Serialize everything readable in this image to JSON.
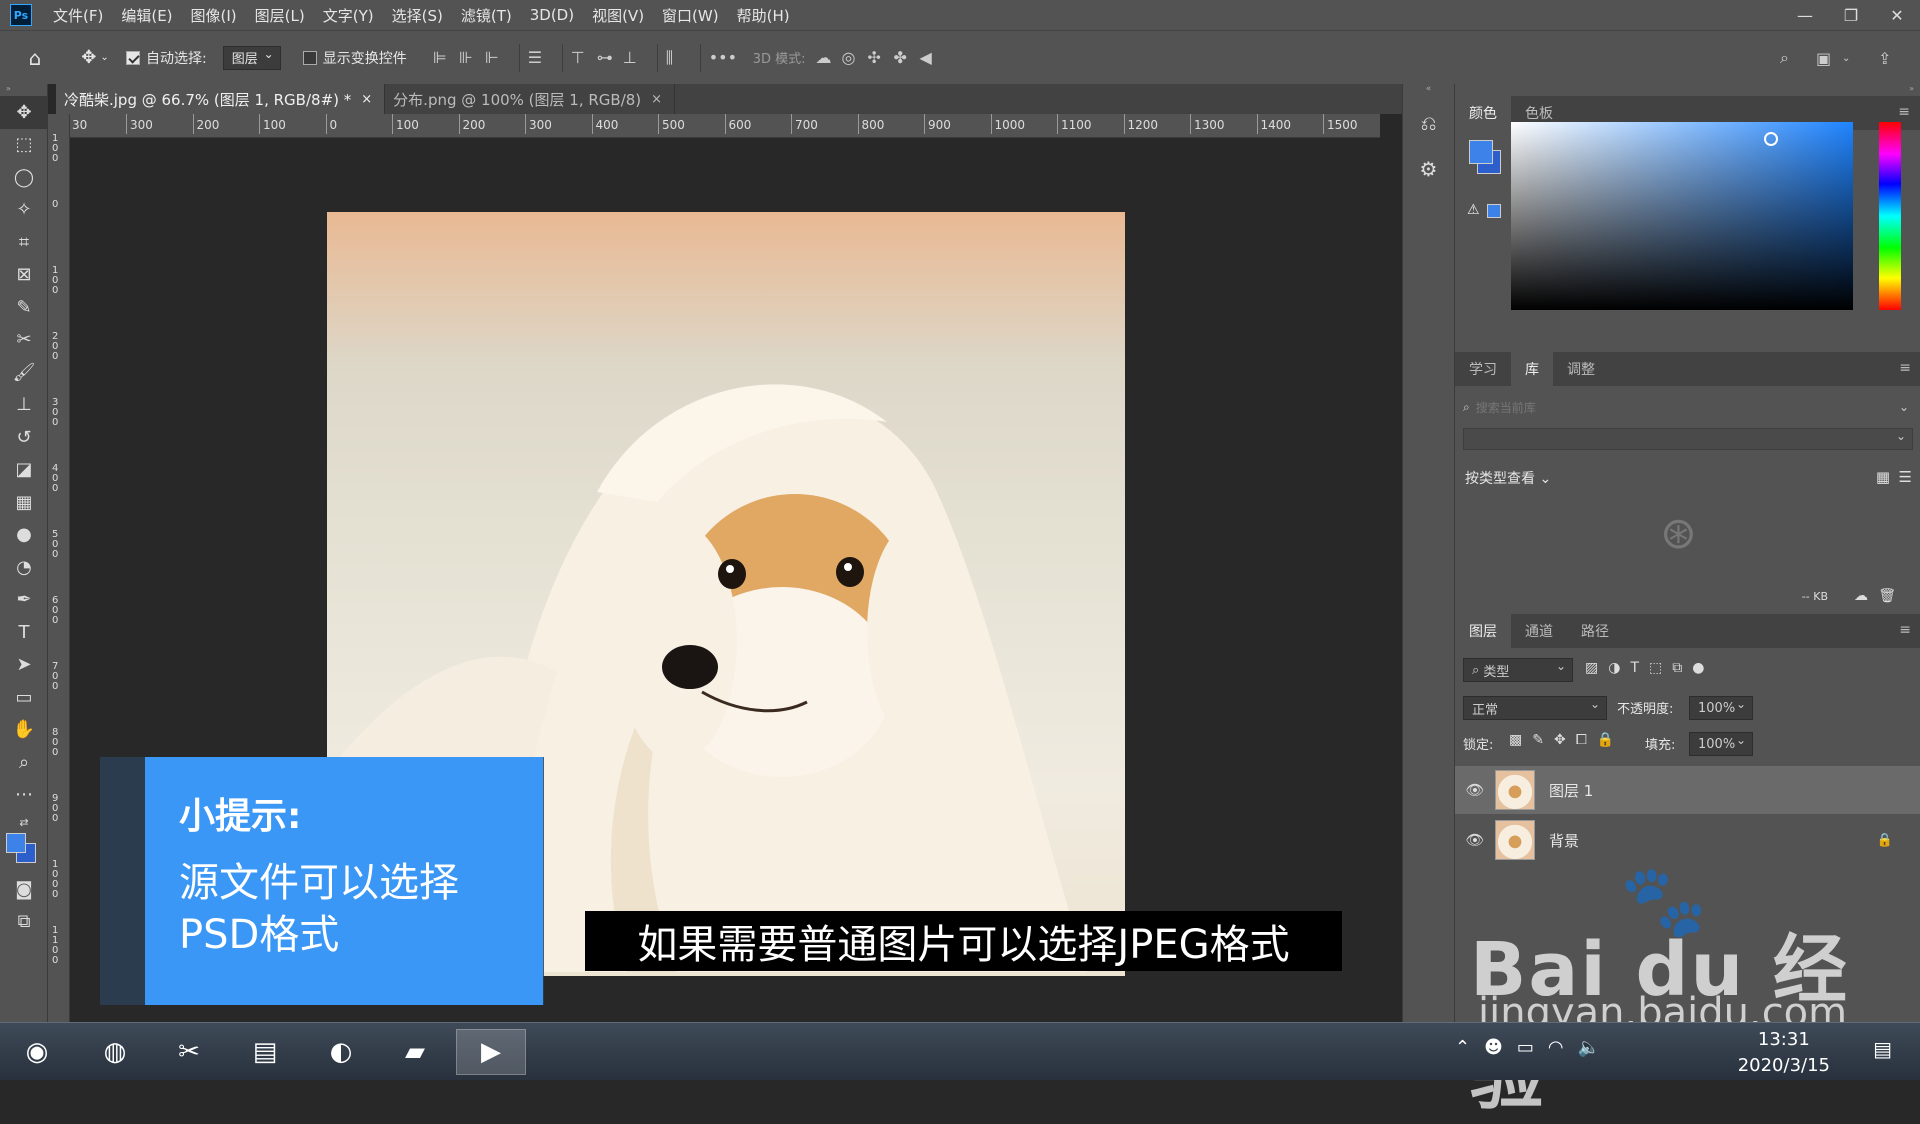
{
  "menubar": {
    "logo": "Ps",
    "items": [
      "文件(F)",
      "编辑(E)",
      "图像(I)",
      "图层(L)",
      "文字(Y)",
      "选择(S)",
      "滤镜(T)",
      "3D(D)",
      "视图(V)",
      "窗口(W)",
      "帮助(H)"
    ]
  },
  "options": {
    "auto_select_label": "自动选择:",
    "auto_select_value": "图层",
    "show_transform_label": "显示变换控件",
    "mode3d_label": "3D 模式:",
    "more": "•••"
  },
  "tabs": [
    {
      "label": "冷酷柴.jpg @ 66.7% (图层 1, RGB/8#) *",
      "close": "×"
    },
    {
      "label": "分布.png @ 100% (图层 1, RGB/8)",
      "close": "×"
    }
  ],
  "ruler": {
    "h_ticks": [
      "30",
      "300",
      "200",
      "100",
      "0",
      "100",
      "200",
      "300",
      "400",
      "500",
      "600",
      "700",
      "800",
      "900",
      "1000",
      "1100",
      "1200",
      "1300",
      "1400",
      "1500"
    ],
    "v_ticks": [
      "1 0 0",
      "0",
      "1 0 0",
      "2 0 0",
      "3 0 0",
      "4 0 0",
      "5 0 0",
      "6 0 0",
      "7 0 0",
      "8 0 0",
      "9 0 0",
      "1 0 0 0",
      "1 1 0 0"
    ]
  },
  "tip": {
    "title": "小提示:",
    "line1": "源文件可以选择",
    "line2": "PSD格式"
  },
  "subtitle": "如果需要普通图片可以选择JPEG格式",
  "color_panel": {
    "tabs": [
      "颜色",
      "色板"
    ],
    "fg_color": "#3c82e8",
    "bg_color": "#2c5fcc"
  },
  "library_panel": {
    "tabs": [
      "学习",
      "库",
      "调整"
    ],
    "search_placeholder": "搜索当前库",
    "view_by": "按类型查看",
    "size": "-- KB"
  },
  "layers_panel": {
    "tabs": [
      "图层",
      "通道",
      "路径"
    ],
    "filter_type": "类型",
    "blend_mode": "正常",
    "opacity_label": "不透明度:",
    "opacity_value": "100%",
    "lock_label": "锁定:",
    "fill_label": "填充:",
    "fill_value": "100%",
    "layers": [
      {
        "name": "图层 1",
        "selected": true
      },
      {
        "name": "背景",
        "locked": true
      }
    ]
  },
  "taskbar": {
    "time": "13:31",
    "date": "2020/3/15"
  },
  "watermark": {
    "brand": "Bai du 经验",
    "url": "jingyan.baidu.com"
  }
}
